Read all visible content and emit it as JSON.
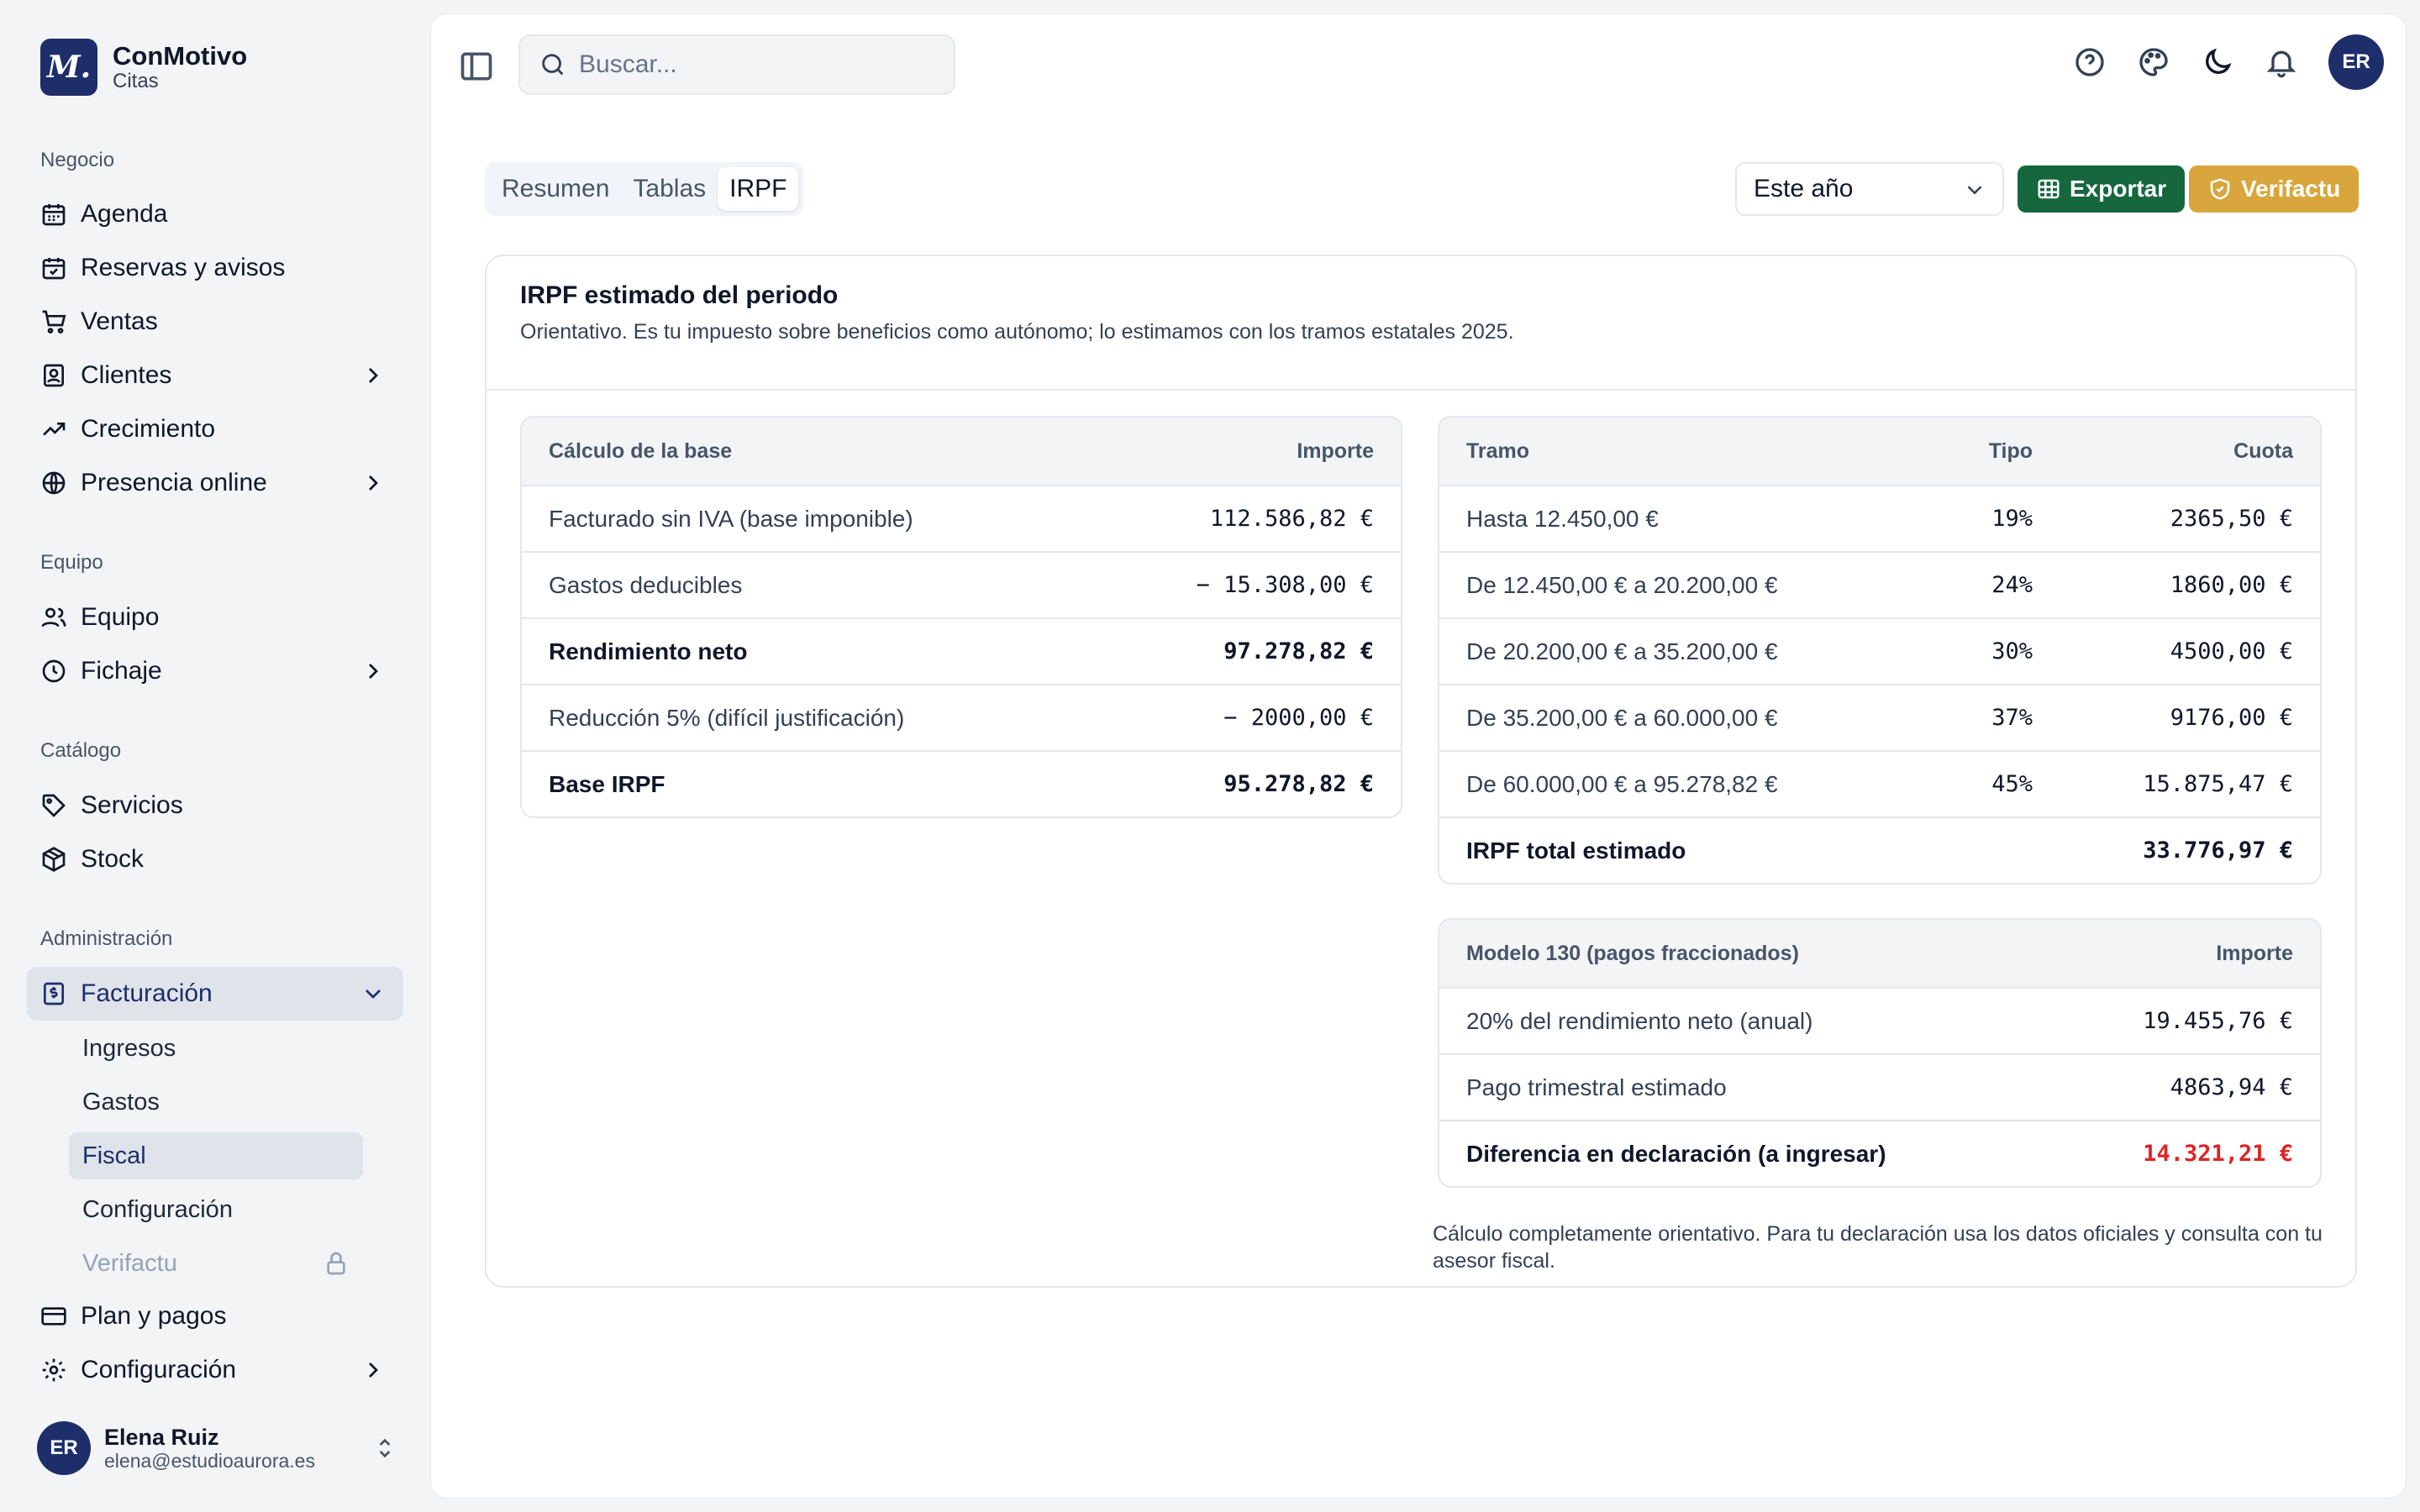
{
  "brand": {
    "logo_letter": "M.",
    "name": "ConMotivo",
    "subtitle": "Citas"
  },
  "sidebar": {
    "sections": [
      {
        "label": "Negocio"
      },
      {
        "label": "Equipo"
      },
      {
        "label": "Catálogo"
      },
      {
        "label": "Administración"
      }
    ],
    "items": {
      "agenda": "Agenda",
      "reservas": "Reservas y avisos",
      "ventas": "Ventas",
      "clientes": "Clientes",
      "crecimiento": "Crecimiento",
      "presencia": "Presencia online",
      "equipo": "Equipo",
      "fichaje": "Fichaje",
      "servicios": "Servicios",
      "stock": "Stock",
      "facturacion": "Facturación",
      "plan": "Plan y pagos",
      "configuracion": "Configuración"
    },
    "facturacion_sub": {
      "ingresos": "Ingresos",
      "gastos": "Gastos",
      "fiscal": "Fiscal",
      "configuracion": "Configuración",
      "verifactu": "Verifactu"
    },
    "user": {
      "initials": "ER",
      "name": "Elena Ruiz",
      "email": "elena@estudioaurora.es"
    }
  },
  "header": {
    "search_placeholder": "Buscar...",
    "avatar_initials": "ER"
  },
  "toolbar": {
    "tabs": [
      "Resumen",
      "Tablas",
      "IRPF"
    ],
    "active_tab": "IRPF",
    "period": "Este año",
    "export_label": "Exportar",
    "verifactu_label": "Verifactu"
  },
  "card": {
    "title": "IRPF estimado del periodo",
    "description": "Orientativo. Es tu impuesto sobre beneficios como autónomo; lo estimamos con los tramos estatales 2025."
  },
  "base_table": {
    "headers": {
      "label": "Cálculo de la base",
      "amount": "Importe"
    },
    "rows": [
      {
        "label": "Facturado sin IVA (base imponible)",
        "amount": "112.586,82 €",
        "bold": false
      },
      {
        "label": "Gastos deducibles",
        "amount": "− 15.308,00 €",
        "bold": false
      },
      {
        "label": "Rendimiento neto",
        "amount": "97.278,82 €",
        "bold": true
      },
      {
        "label": "Reducción 5% (difícil justificación)",
        "amount": "− 2000,00 €",
        "bold": false
      },
      {
        "label": "Base IRPF",
        "amount": "95.278,82 €",
        "bold": true
      }
    ]
  },
  "tramos_table": {
    "headers": {
      "tramo": "Tramo",
      "tipo": "Tipo",
      "cuota": "Cuota"
    },
    "rows": [
      {
        "tramo": "Hasta 12.450,00 €",
        "tipo": "19%",
        "cuota": "2365,50 €"
      },
      {
        "tramo": "De 12.450,00 € a 20.200,00 €",
        "tipo": "24%",
        "cuota": "1860,00 €"
      },
      {
        "tramo": "De 20.200,00 € a 35.200,00 €",
        "tipo": "30%",
        "cuota": "4500,00 €"
      },
      {
        "tramo": "De 35.200,00 € a 60.000,00 €",
        "tipo": "37%",
        "cuota": "9176,00 €"
      },
      {
        "tramo": "De 60.000,00 € a 95.278,82 €",
        "tipo": "45%",
        "cuota": "15.875,47 €"
      }
    ],
    "total": {
      "label": "IRPF total estimado",
      "amount": "33.776,97 €"
    }
  },
  "modelo130_table": {
    "headers": {
      "label": "Modelo 130 (pagos fraccionados)",
      "amount": "Importe"
    },
    "rows": [
      {
        "label": "20% del rendimiento neto (anual)",
        "amount": "19.455,76 €"
      },
      {
        "label": "Pago trimestral estimado",
        "amount": "4863,94 €"
      }
    ],
    "diff": {
      "label": "Diferencia en declaración (a ingresar)",
      "amount": "14.321,21 €"
    }
  },
  "footnote": "Cálculo completamente orientativo. Para tu declaración usa los datos oficiales y consulta con tu asesor fiscal.",
  "colors": {
    "brand_navy": "#1e2e6b",
    "export_green": "#16673e",
    "verifactu_gold": "#d8a63c",
    "negative_red": "#dc2626"
  }
}
